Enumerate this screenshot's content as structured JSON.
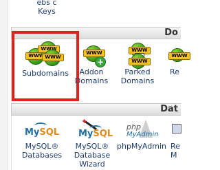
{
  "top": {
    "label_partial": "Keys"
  },
  "domains_section": {
    "header": "Do",
    "items": [
      {
        "label_line1": "Subdomains",
        "label_line2": ""
      },
      {
        "label_line1": "Addon",
        "label_line2": "Domains"
      },
      {
        "label_line1": "Parked",
        "label_line2": "Domains"
      },
      {
        "label_line1": "Re",
        "label_line2": ""
      }
    ]
  },
  "databases_section": {
    "header": "Dat",
    "items": [
      {
        "label_line1": "MySQL®",
        "label_line2": "Databases"
      },
      {
        "label_line1": "MySQL®",
        "label_line2": "Database",
        "label_line3": "Wizard"
      },
      {
        "label_line1": "phpMyAdmin",
        "label_line2": ""
      },
      {
        "label_line1": "Re",
        "label_line2": "M"
      }
    ],
    "icon_text": {
      "mysql_my": "My",
      "mysql_sql": "SQL",
      "php": "php",
      "myadmin": "MyAdmin"
    }
  },
  "colors": {
    "highlight": "#e0231c",
    "link_text": "#1b3b6f"
  }
}
